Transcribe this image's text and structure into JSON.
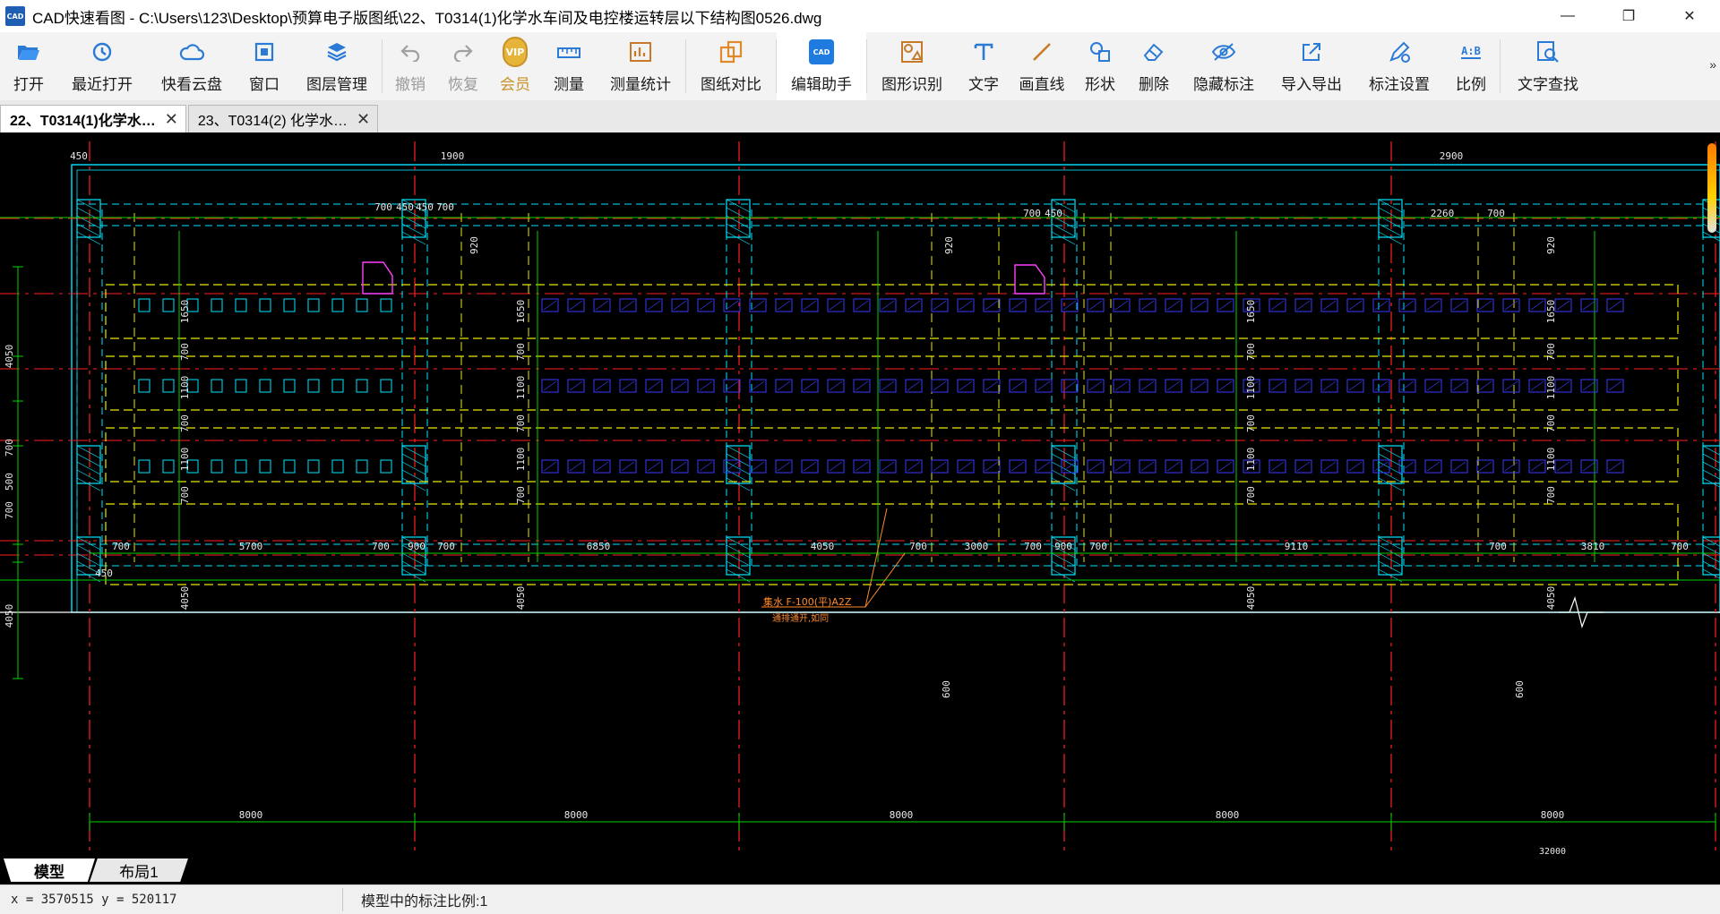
{
  "window": {
    "app_icon_text": "CAD",
    "title": "CAD快速看图 - C:\\Users\\123\\Desktop\\预算电子版图纸\\22、T0314(1)化学水车间及电控楼运转层以下结构图0526.dwg",
    "controls": [
      "—",
      "❐",
      "✕"
    ]
  },
  "toolbar": {
    "items": [
      {
        "id": "open",
        "label": "打开",
        "icon": "folder-open-icon"
      },
      {
        "id": "recent",
        "label": "最近打开",
        "icon": "clock-history-icon"
      },
      {
        "id": "cloud",
        "label": "快看云盘",
        "icon": "cloud-icon"
      },
      {
        "id": "window",
        "label": "窗口",
        "icon": "window-icon"
      },
      {
        "id": "layers",
        "label": "图层管理",
        "icon": "layers-icon"
      },
      {
        "id": "undo",
        "label": "撤销",
        "icon": "undo-icon",
        "disabled": true
      },
      {
        "id": "redo",
        "label": "恢复",
        "icon": "redo-icon",
        "disabled": true
      },
      {
        "id": "vip",
        "label": "会员",
        "icon": "vip-badge-icon",
        "badge": "VIP"
      },
      {
        "id": "measure",
        "label": "测量",
        "icon": "ruler-icon"
      },
      {
        "id": "measure_stats",
        "label": "测量统计",
        "icon": "chart-measure-icon"
      },
      {
        "id": "compare",
        "label": "图纸对比",
        "icon": "compare-icon"
      },
      {
        "id": "assistant",
        "label": "编辑助手",
        "icon": "cad-edit-icon",
        "badge": "CAD"
      },
      {
        "id": "shape_recog",
        "label": "图形识别",
        "icon": "shape-recognize-icon"
      },
      {
        "id": "text",
        "label": "文字",
        "icon": "text-t-icon"
      },
      {
        "id": "line",
        "label": "画直线",
        "icon": "line-icon"
      },
      {
        "id": "shape",
        "label": "形状",
        "icon": "shape-icon"
      },
      {
        "id": "delete",
        "label": "删除",
        "icon": "eraser-icon"
      },
      {
        "id": "hide_ann",
        "label": "隐藏标注",
        "icon": "eye-hide-icon"
      },
      {
        "id": "import_export",
        "label": "导入导出",
        "icon": "export-icon"
      },
      {
        "id": "ann_settings",
        "label": "标注设置",
        "icon": "annotation-settings-icon"
      },
      {
        "id": "scale",
        "label": "比例",
        "icon": "scale-ab-icon",
        "badge": "A:B"
      },
      {
        "id": "find_text",
        "label": "文字查找",
        "icon": "find-text-icon"
      }
    ],
    "more": "»"
  },
  "tabs": [
    {
      "label": "22、T0314(1)化学水…",
      "active": true,
      "close": "✕"
    },
    {
      "label": "23、T0314(2) 化学水…",
      "active": false,
      "close": "✕"
    }
  ],
  "drawing": {
    "top_dims": [
      "450",
      "1900",
      "700",
      "450",
      "450",
      "700",
      "920",
      "700",
      "450",
      "920",
      "2900",
      "2260",
      "700",
      "920"
    ],
    "row_dims": [
      "700",
      "5700",
      "700",
      "900",
      "700",
      "6850",
      "4050",
      "700",
      "3000",
      "700",
      "900",
      "700",
      "9110",
      "700",
      "3810",
      "700"
    ],
    "left_dims": [
      "4050",
      "700",
      "500",
      "700",
      "4050"
    ],
    "vertical_labels": [
      "1650",
      "700",
      "1100",
      "700",
      "1100",
      "700",
      "4050",
      "600"
    ],
    "bottom_dims": [
      "8000",
      "8000",
      "8000",
      "8000",
      "8000"
    ],
    "bottom_partial": "32000",
    "note_line1": "集水 F-100(平)A2Z",
    "note_line2": "通排通开,如同",
    "small_450": "450"
  },
  "layouts": [
    {
      "label": "模型",
      "active": true
    },
    {
      "label": "布局1",
      "active": false
    }
  ],
  "status": {
    "coords": "x = 3570515 y = 520117",
    "scale_text": "模型中的标注比例:1"
  },
  "colors": {
    "title_bg": "#ffffff",
    "toolbar_bg": "#f3f3f3",
    "canvas_bg": "#000000",
    "cyan": "#00e5ff",
    "green": "#00d400",
    "yellow": "#e8e800",
    "red": "#ff2020",
    "blue": "#3a3aff",
    "magenta": "#ff40ff",
    "orange": "#ff8a2a"
  }
}
